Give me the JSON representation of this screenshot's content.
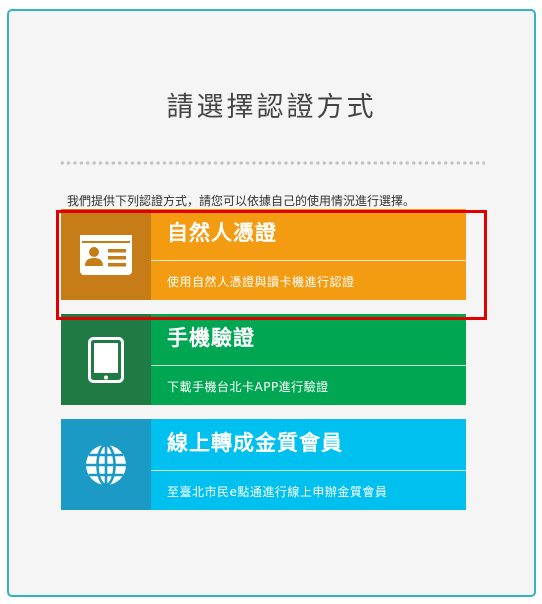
{
  "page": {
    "title": "請選擇認證方式",
    "subtitle": "我們提供下列認證方式，請您可以依據自己的使用情況進行選擇。"
  },
  "options": [
    {
      "title": "自然人憑證",
      "description": "使用自然人憑證與讀卡機進行認證",
      "icon": "id-card-icon",
      "color_dark": "#c67c17",
      "color_main": "#f39c12"
    },
    {
      "title": "手機驗證",
      "description": "下載手機台北卡APP進行驗證",
      "icon": "tablet-icon",
      "color_dark": "#1f7a43",
      "color_main": "#00a651"
    },
    {
      "title": "線上轉成金質會員",
      "description": "至臺北市民e點通進行線上申辦金質會員",
      "icon": "globe-icon",
      "color_dark": "#1b9ac6",
      "color_main": "#00c0ef"
    }
  ],
  "highlight": {
    "target": "自然人憑證",
    "color": "#e00000"
  },
  "theme": {
    "panel_border": "#34b3c4",
    "panel_bg": "#f5f5f5"
  }
}
